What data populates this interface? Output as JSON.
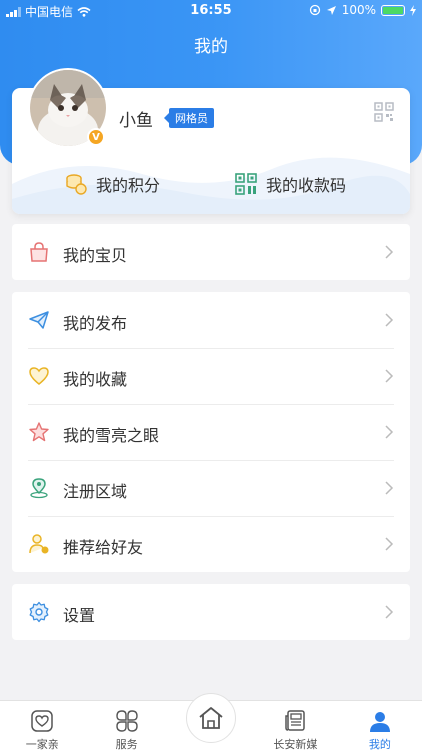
{
  "status_bar": {
    "carrier": "中国电信",
    "time": "16:55",
    "battery": "100%"
  },
  "page_title": "我的",
  "profile": {
    "username": "小鱼",
    "role": "网格员",
    "verified_mark": "V",
    "points_label": "我的积分",
    "paycode_label": "我的收款码"
  },
  "menu": {
    "treasure": "我的宝贝",
    "publish": "我的发布",
    "favorites": "我的收藏",
    "eyes": "我的雪亮之眼",
    "region": "注册区域",
    "recommend": "推荐给好友",
    "settings": "设置"
  },
  "tabs": [
    {
      "label": "一家亲"
    },
    {
      "label": "服务"
    },
    {
      "label": "长安新媒"
    },
    {
      "label": "我的"
    }
  ],
  "colors": {
    "accent": "#2b7de6",
    "header": "#3a95f5"
  }
}
